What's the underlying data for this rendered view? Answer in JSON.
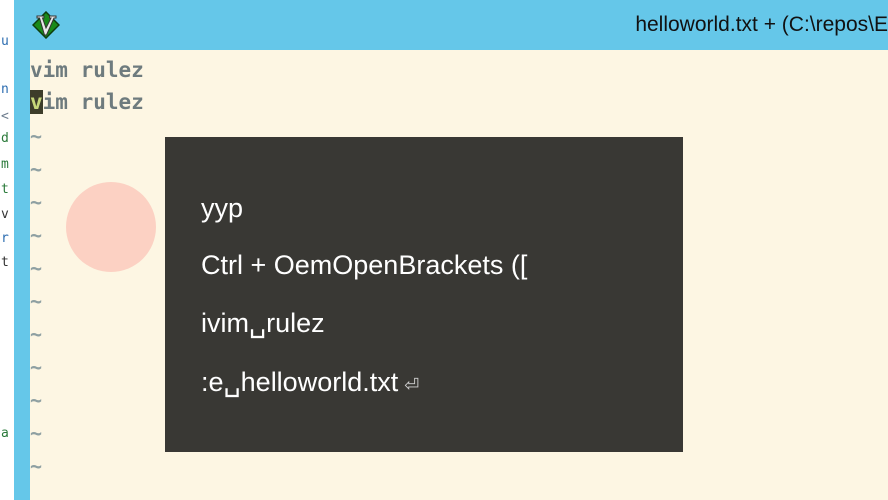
{
  "window": {
    "title": "helloworld.txt + (C:\\repos\\E"
  },
  "background_window": {
    "fragments": [
      "u",
      "n",
      "<",
      "d",
      "m",
      "t",
      "v",
      "r",
      "t",
      "a"
    ],
    "fragment_colors": [
      "#2b6cb0",
      "#2b6cb0",
      "#6b7b8c",
      "#2a7a3a",
      "#2a7a3a",
      "#2a7a3a",
      "#333333",
      "#2b6cb0",
      "#333333",
      "#2a7a3a"
    ]
  },
  "editor": {
    "lines": [
      {
        "cursor_char": "",
        "text": "vim rulez"
      },
      {
        "cursor_char": "v",
        "text": "im rulez"
      }
    ],
    "empty_line_marker": "~",
    "empty_line_count": 11
  },
  "keystroke_overlay": {
    "entries": [
      {
        "text": "yyp",
        "suffix": ""
      },
      {
        "text": "Ctrl + OemOpenBrackets ([",
        "suffix": ""
      },
      {
        "text": "ivim␣rulez",
        "suffix": ""
      },
      {
        "text": ":e␣helloworld.txt",
        "suffix": "⏎"
      }
    ]
  },
  "colors": {
    "titlebar": "#65c7e9",
    "editor_background": "#fdf6e3",
    "overlay_background": "#393834",
    "click_indicator": "#fccabd"
  }
}
